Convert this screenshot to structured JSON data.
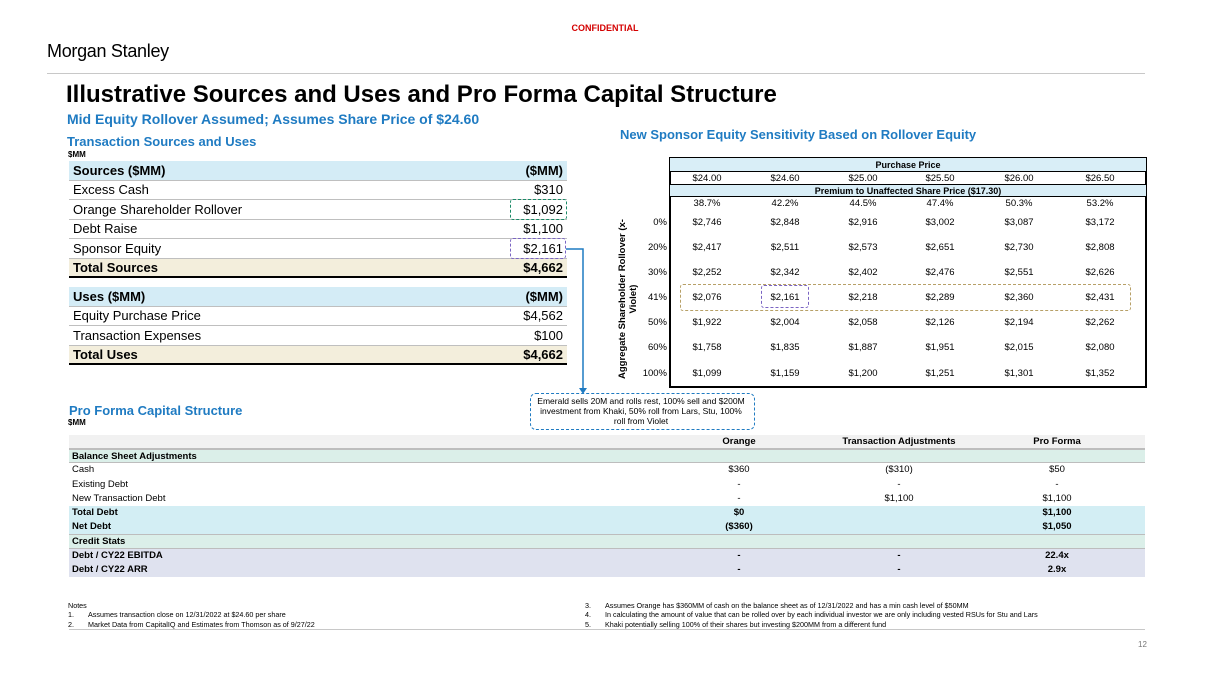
{
  "header": {
    "confidential": "CONFIDENTIAL",
    "brand": "Morgan Stanley",
    "page_number": "12"
  },
  "title": "Illustrative Sources and Uses and Pro Forma Capital Structure",
  "subtitle": "Mid Equity Rollover Assumed; Assumes Share Price of $24.60",
  "sources_uses": {
    "section_title": "Transaction Sources and Uses",
    "unit": "$MM",
    "sources_header": {
      "label": "Sources ($MM)",
      "value": "($MM)"
    },
    "sources": [
      {
        "label": "Excess Cash",
        "value": "$310"
      },
      {
        "label": "Orange Shareholder Rollover",
        "value": "$1,092"
      },
      {
        "label": "Debt Raise",
        "value": "$1,100"
      },
      {
        "label": "Sponsor Equity",
        "value": "$2,161"
      }
    ],
    "sources_total": {
      "label": "Total Sources",
      "value": "$4,662"
    },
    "uses_header": {
      "label": "Uses ($MM)",
      "value": "($MM)"
    },
    "uses": [
      {
        "label": "Equity Purchase Price",
        "value": "$4,562"
      },
      {
        "label": "Transaction Expenses",
        "value": "$100"
      }
    ],
    "uses_total": {
      "label": "Total Uses",
      "value": "$4,662"
    }
  },
  "sensitivity": {
    "section_title": "New Sponsor Equity Sensitivity Based on Rollover Equity",
    "purchase_price_label": "Purchase Price",
    "prices": [
      "$24.00",
      "$24.60",
      "$25.00",
      "$25.50",
      "$26.00",
      "$26.50"
    ],
    "premium_label": "Premium to Unaffected Share Price ($17.30)",
    "premiums": [
      "38.7%",
      "42.2%",
      "44.5%",
      "47.4%",
      "50.3%",
      "53.2%"
    ],
    "row_axis_label": "Aggregate Shareholder Rollover (x-Violet)",
    "rows": [
      {
        "label": "0%",
        "values": [
          "$2,746",
          "$2,848",
          "$2,916",
          "$3,002",
          "$3,087",
          "$3,172"
        ]
      },
      {
        "label": "20%",
        "values": [
          "$2,417",
          "$2,511",
          "$2,573",
          "$2,651",
          "$2,730",
          "$2,808"
        ]
      },
      {
        "label": "30%",
        "values": [
          "$2,252",
          "$2,342",
          "$2,402",
          "$2,476",
          "$2,551",
          "$2,626"
        ]
      },
      {
        "label": "41%",
        "values": [
          "$2,076",
          "$2,161",
          "$2,218",
          "$2,289",
          "$2,360",
          "$2,431"
        ]
      },
      {
        "label": "50%",
        "values": [
          "$1,922",
          "$2,004",
          "$2,058",
          "$2,126",
          "$2,194",
          "$2,262"
        ]
      },
      {
        "label": "60%",
        "values": [
          "$1,758",
          "$1,835",
          "$1,887",
          "$1,951",
          "$2,015",
          "$2,080"
        ]
      },
      {
        "label": "100%",
        "values": [
          "$1,099",
          "$1,159",
          "$1,200",
          "$1,251",
          "$1,301",
          "$1,352"
        ]
      }
    ]
  },
  "callout": "Emerald sells 20M and rolls rest, 100% sell and $200M investment from Khaki, 50% roll from Lars, Stu, 100% roll from Violet",
  "pro_forma": {
    "section_title": "Pro Forma Capital Structure",
    "unit": "$MM",
    "columns": [
      "Orange",
      "Transaction Adjustments",
      "Pro Forma"
    ],
    "balance_sheet_label": "Balance Sheet Adjustments",
    "balance_rows": [
      {
        "label": "Cash",
        "values": [
          "$360",
          "($310)",
          "$50"
        ]
      },
      {
        "label": "Existing Debt",
        "values": [
          "-",
          "-",
          "-"
        ]
      },
      {
        "label": "New Transaction Debt",
        "values": [
          "-",
          "$1,100",
          "$1,100"
        ]
      }
    ],
    "total_debt": {
      "label": "Total Debt",
      "values": [
        "$0",
        "",
        "$1,100"
      ]
    },
    "net_debt": {
      "label": "Net Debt",
      "values": [
        "($360)",
        "",
        "$1,050"
      ]
    },
    "credit_stats_label": "Credit Stats",
    "credit_rows": [
      {
        "label": "Debt / CY22 EBITDA",
        "values": [
          "-",
          "-",
          "22.4x"
        ]
      },
      {
        "label": "Debt / CY22 ARR",
        "values": [
          "-",
          "-",
          "2.9x"
        ]
      }
    ]
  },
  "notes": {
    "heading": "Notes",
    "left": [
      {
        "num": "1.",
        "text": "Assumes transaction close on 12/31/2022 at $24.60 per share"
      },
      {
        "num": "2.",
        "text": "Market Data from CapitalIQ and Estimates from Thomson as of 9/27/22"
      }
    ],
    "right": [
      {
        "num": "3.",
        "text": "Assumes Orange has $360MM of cash on the balance sheet as of 12/31/2022 and has a min cash level of $50MM"
      },
      {
        "num": "4.",
        "text": "In calculating the amount of value that can be rolled over by each individual investor we are only including vested  RSUs for Stu and Lars"
      },
      {
        "num": "5.",
        "text": "Khaki potentially selling 100% of their shares but investing $200MM from a different fund"
      }
    ]
  },
  "colors": {
    "accent_blue": "#1f7bc2",
    "confidential_red": "#d40000",
    "green_highlight": "#1a8a67",
    "purple_highlight": "#7a64c3",
    "gold_highlight": "#b7a067"
  }
}
